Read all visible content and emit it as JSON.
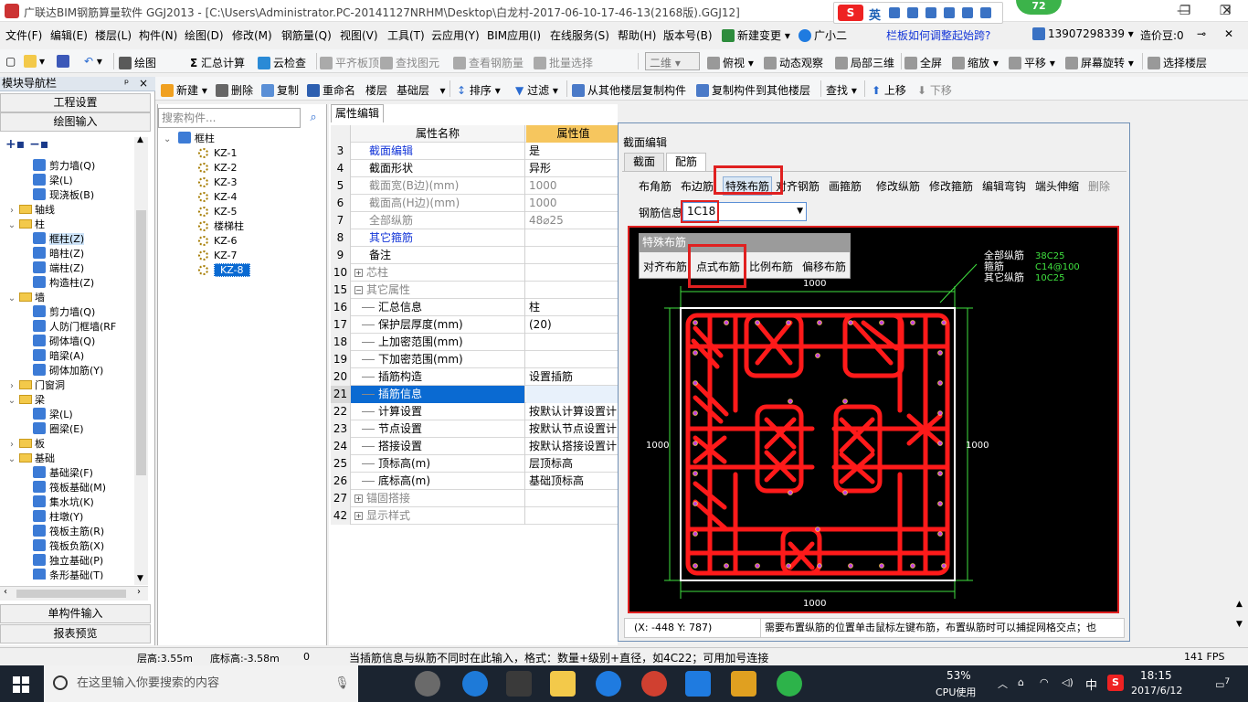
{
  "title": "广联达BIM钢筋算量软件 GGJ2013 - [C:\\Users\\Administrator.PC-20141127NRHM\\Desktop\\白龙村-2017-06-10-17-46-13(2168版).GGJ12]",
  "ime": {
    "label": "英",
    "badge": "72"
  },
  "menu": [
    "文件(F)",
    "编辑(E)",
    "楼层(L)",
    "构件(N)",
    "绘图(D)",
    "修改(M)",
    "钢筋量(Q)",
    "视图(V)",
    "工具(T)",
    "云应用(Y)",
    "BIM应用(I)",
    "在线服务(S)",
    "帮助(H)",
    "版本号(B)",
    "新建变更",
    "广小二",
    "栏板如何调整起始跨?",
    "13907298339",
    "造价豆:0"
  ],
  "toolbar1": {
    "draw": "绘图",
    "sum": "汇总计算",
    "cloud": "云检查",
    "flat": "平齐板顶",
    "find": "查找图元",
    "viewqty": "查看钢筋量",
    "batch": "批量选择",
    "view2d": "二维",
    "top": "俯视",
    "dyn": "动态观察",
    "local3d": "局部三维",
    "fullscreen": "全屏",
    "zoom": "缩放",
    "pan": "平移",
    "rotate": "屏幕旋转",
    "selfloor": "选择楼层"
  },
  "toolbar2": {
    "new": "新建",
    "delete": "删除",
    "copy": "复制",
    "rename": "重命名",
    "floor": "楼层",
    "floorval": "基础层",
    "sort": "排序",
    "filter": "过滤",
    "copyfrom": "从其他楼层复制构件",
    "copyto": "复制构件到其他楼层",
    "find": "查找",
    "up": "上移",
    "down": "下移"
  },
  "leftpanel": {
    "header": "模块导航栏",
    "btn_settings": "工程设置",
    "btn_draw": "绘图输入",
    "btn_single": "单构件输入",
    "btn_report": "报表预览",
    "tree": [
      {
        "label": "剪力墙(Q)",
        "lvl": 2
      },
      {
        "label": "梁(L)",
        "lvl": 2
      },
      {
        "label": "现浇板(B)",
        "lvl": 2
      },
      {
        "label": "轴线",
        "lvl": 0,
        "folder": true,
        "exp": "›"
      },
      {
        "label": "柱",
        "lvl": 0,
        "folder": true,
        "exp": "⌄"
      },
      {
        "label": "框柱(Z)",
        "lvl": 2,
        "sel": true
      },
      {
        "label": "暗柱(Z)",
        "lvl": 2
      },
      {
        "label": "端柱(Z)",
        "lvl": 2
      },
      {
        "label": "构造柱(Z)",
        "lvl": 2
      },
      {
        "label": "墙",
        "lvl": 0,
        "folder": true,
        "exp": "⌄"
      },
      {
        "label": "剪力墙(Q)",
        "lvl": 2
      },
      {
        "label": "人防门框墙(RF",
        "lvl": 2
      },
      {
        "label": "砌体墙(Q)",
        "lvl": 2
      },
      {
        "label": "暗梁(A)",
        "lvl": 2
      },
      {
        "label": "砌体加筋(Y)",
        "lvl": 2
      },
      {
        "label": "门窗洞",
        "lvl": 0,
        "folder": true,
        "exp": "›"
      },
      {
        "label": "梁",
        "lvl": 0,
        "folder": true,
        "exp": "⌄"
      },
      {
        "label": "梁(L)",
        "lvl": 2
      },
      {
        "label": "圈梁(E)",
        "lvl": 2
      },
      {
        "label": "板",
        "lvl": 0,
        "folder": true,
        "exp": "›"
      },
      {
        "label": "基础",
        "lvl": 0,
        "folder": true,
        "exp": "⌄"
      },
      {
        "label": "基础梁(F)",
        "lvl": 2
      },
      {
        "label": "筏板基础(M)",
        "lvl": 2
      },
      {
        "label": "集水坑(K)",
        "lvl": 2
      },
      {
        "label": "柱墩(Y)",
        "lvl": 2
      },
      {
        "label": "筏板主筋(R)",
        "lvl": 2
      },
      {
        "label": "筏板负筋(X)",
        "lvl": 2
      },
      {
        "label": "独立基础(P)",
        "lvl": 2
      },
      {
        "label": "条形基础(T)",
        "lvl": 2
      }
    ]
  },
  "midpanel": {
    "search_placeholder": "搜索构件...",
    "root": "框柱",
    "items": [
      "KZ-1",
      "KZ-2",
      "KZ-3",
      "KZ-4",
      "KZ-5",
      "楼梯柱",
      "KZ-6",
      "KZ-7",
      "KZ-8"
    ],
    "selected": "KZ-8"
  },
  "props": {
    "tab": "属性编辑",
    "col_name": "属性名称",
    "col_val": "属性值",
    "rows": [
      {
        "n": "3",
        "k": "截面编辑",
        "v": "是",
        "c": "blue"
      },
      {
        "n": "4",
        "k": "截面形状",
        "v": "异形",
        "c": ""
      },
      {
        "n": "5",
        "k": "截面宽(B边)(mm)",
        "v": "1000",
        "c": "gray"
      },
      {
        "n": "6",
        "k": "截面高(H边)(mm)",
        "v": "1000",
        "c": "gray"
      },
      {
        "n": "7",
        "k": "全部纵筋",
        "v": "48⌀25",
        "c": "gray"
      },
      {
        "n": "8",
        "k": "其它箍筋",
        "v": "",
        "c": "blue"
      },
      {
        "n": "9",
        "k": "备注",
        "v": "",
        "c": ""
      },
      {
        "n": "10",
        "k": "芯柱",
        "v": "",
        "c": "gray",
        "box": "+"
      },
      {
        "n": "15",
        "k": "其它属性",
        "v": "",
        "c": "gray",
        "box": "−"
      },
      {
        "n": "16",
        "k": "汇总信息",
        "v": "柱",
        "c": "",
        "sub": true
      },
      {
        "n": "17",
        "k": "保护层厚度(mm)",
        "v": "(20)",
        "c": "",
        "sub": true
      },
      {
        "n": "18",
        "k": "上加密范围(mm)",
        "v": "",
        "c": "",
        "sub": true
      },
      {
        "n": "19",
        "k": "下加密范围(mm)",
        "v": "",
        "c": "",
        "sub": true
      },
      {
        "n": "20",
        "k": "插筋构造",
        "v": "设置插筋",
        "c": "",
        "sub": true
      },
      {
        "n": "21",
        "k": "插筋信息",
        "v": "",
        "c": "",
        "sub": true,
        "hl": true
      },
      {
        "n": "22",
        "k": "计算设置",
        "v": "按默认计算设置计",
        "c": "",
        "sub": true
      },
      {
        "n": "23",
        "k": "节点设置",
        "v": "按默认节点设置计",
        "c": "",
        "sub": true
      },
      {
        "n": "24",
        "k": "搭接设置",
        "v": "按默认搭接设置计",
        "c": "",
        "sub": true
      },
      {
        "n": "25",
        "k": "顶标高(m)",
        "v": "层顶标高",
        "c": "",
        "sub": true
      },
      {
        "n": "26",
        "k": "底标高(m)",
        "v": "基础顶标高",
        "c": "",
        "sub": true
      },
      {
        "n": "27",
        "k": "锚固搭接",
        "v": "",
        "c": "gray",
        "box": "+"
      },
      {
        "n": "42",
        "k": "显示样式",
        "v": "",
        "c": "gray",
        "box": "+"
      }
    ]
  },
  "dialog": {
    "title": "截面编辑",
    "tab_section": "截面",
    "tab_rebar": "配筋",
    "buttons": [
      "布角筋",
      "布边筋",
      "特殊布筋",
      "对齐钢筋",
      "画箍筋",
      "修改纵筋",
      "修改箍筋",
      "编辑弯钩",
      "端头伸缩",
      "删除"
    ],
    "rebar_info_label": "钢筋信息",
    "rebar_info_value": "1C18",
    "popup_title": "特殊布筋",
    "popup_buttons": [
      "对齐布筋",
      "点式布筋",
      "比例布筋",
      "偏移布筋"
    ],
    "legend": [
      {
        "k": "全部纵筋",
        "v": "38C25"
      },
      {
        "k": "箍筋",
        "v": "C14@100"
      },
      {
        "k": "其它纵筋",
        "v": "10C25"
      }
    ],
    "dim_top": "1000",
    "dim_bottom": "1000",
    "dim_left": "1000",
    "dim_right": "1000",
    "coords": "(X: -448 Y: 787)",
    "hint": "需要布置纵筋的位置单击鼠标左键布筋，布置纵筋时可以捕捉网格交点；也"
  },
  "statusbar": {
    "floor_h": "层高:3.55m",
    "bottom_h": "底标高:-3.58m",
    "zero": "0",
    "msg": "当插筋信息与纵筋不同时在此输入，格式：数量+级别+直径，如4C22；可用加号连接",
    "fps": "141 FPS"
  },
  "taskbar": {
    "search": "在这里输入你要搜索的内容",
    "cpu_pct": "53%",
    "cpu_label": "CPU使用",
    "ime": "中",
    "time": "18:15",
    "date": "2017/6/12",
    "notif": "7"
  },
  "colors": {
    "accent": "#0a6ad2",
    "red": "#e02020",
    "rebar_green": "#3fe03f"
  }
}
